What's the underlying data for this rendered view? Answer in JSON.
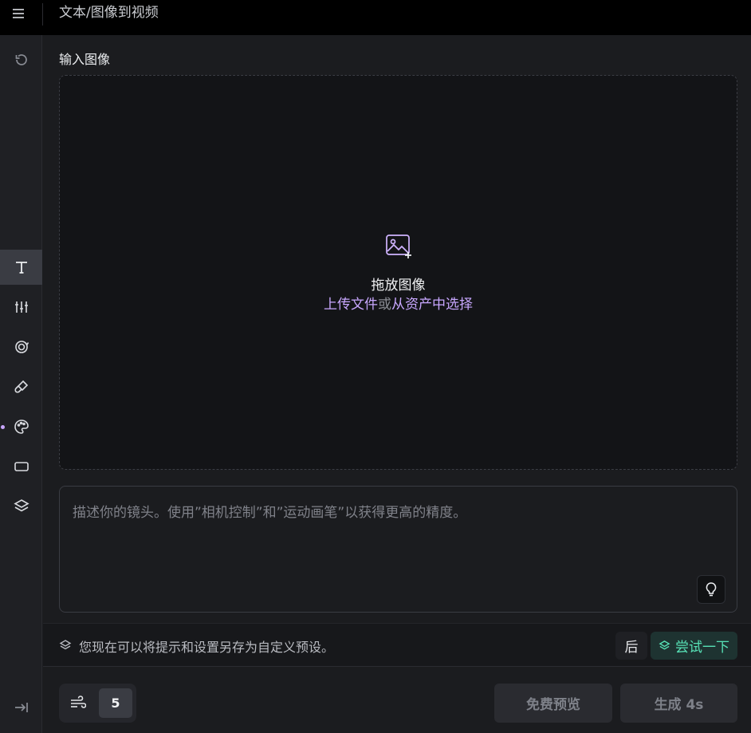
{
  "header": {
    "title": "文本/图像到视频"
  },
  "main": {
    "input_label": "输入图像",
    "dropzone": {
      "title": "拖放图像",
      "upload_link": "上传文件",
      "or_text": "或",
      "assets_link": "从资产中选择"
    },
    "prompt": {
      "placeholder": "描述你的镜头。使用”相机控制”和”运动画笔”以获得更高的精度。"
    },
    "notice": {
      "text": "您现在可以将提示和设置另存为自定义预设。",
      "later_label": "后",
      "try_label": "尝试一下"
    },
    "bottom": {
      "motion_value": "5",
      "preview_label": "免费预览",
      "generate_label": "生成 4s"
    }
  },
  "sidebar": {
    "items": [
      {
        "icon": "undo-icon"
      },
      {
        "icon": "text-icon",
        "active": true
      },
      {
        "icon": "sliders-icon"
      },
      {
        "icon": "camera-rotate-icon"
      },
      {
        "icon": "brush-icon"
      },
      {
        "icon": "palette-icon",
        "dot": true
      },
      {
        "icon": "aspect-ratio-icon"
      },
      {
        "icon": "layers-icon"
      },
      {
        "icon": "collapse-icon"
      }
    ]
  },
  "colors": {
    "accent": "#c8a7ff",
    "try_accent": "#57e0b5"
  }
}
